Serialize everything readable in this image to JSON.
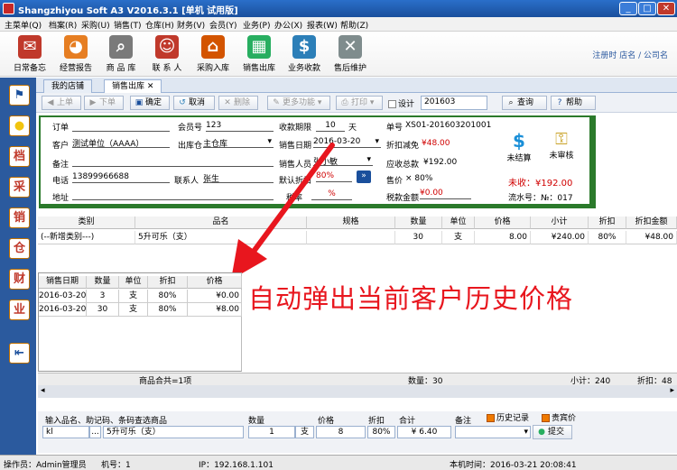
{
  "window": {
    "title": "Shangzhiyou Soft A3 V2016.3.1 [单机 试用版]",
    "min": "_",
    "max": "□",
    "close": "✕"
  },
  "menu": [
    "主菜单(Q)",
    "档案(R)",
    "采购(U)",
    "销售(T)",
    "仓库(H)",
    "财务(V)",
    "会员(Y)",
    "业务(P)",
    "办公(X)",
    "报表(W)",
    "帮助(Z)"
  ],
  "toolbar": [
    {
      "label": "日常备忘",
      "icon": "envelope-icon",
      "glyph": "✉",
      "color": "#c0392b"
    },
    {
      "label": "经营报告",
      "icon": "pie-chart-icon",
      "glyph": "◕",
      "color": "#e67e22"
    },
    {
      "label": "商 品 库",
      "icon": "magnifier-icon",
      "glyph": "⌕",
      "color": "#7a7a7a"
    },
    {
      "label": "联 系 人",
      "icon": "person-icon",
      "glyph": "☺",
      "color": "#c0392b"
    },
    {
      "label": "采购入库",
      "icon": "house-icon",
      "glyph": "⌂",
      "color": "#d35400"
    },
    {
      "label": "销售出库",
      "icon": "cash-icon",
      "glyph": "▦",
      "color": "#27ae60"
    },
    {
      "label": "业务收款",
      "icon": "dollar-icon",
      "glyph": "$",
      "color": "#2c7fb8"
    },
    {
      "label": "售后维护",
      "icon": "tools-icon",
      "glyph": "✕",
      "color": "#7f8c8d"
    }
  ],
  "reginfo": "注册时 店名 / 公司名",
  "sidebar": [
    "⚑",
    "●",
    "档",
    "采",
    "销",
    "仓",
    "财",
    "业",
    "⇤"
  ],
  "tabs": [
    {
      "label": "我的店铺"
    },
    {
      "label": "销售出库",
      "close": "✕"
    }
  ],
  "actions": {
    "prev": "上单",
    "next": "下单",
    "confirm": "确定",
    "cancel": "取消",
    "delete": "删除",
    "more": "更多功能",
    "print": "打印",
    "settings": "设计",
    "period_value": "201603",
    "query": "查询",
    "help": "帮助"
  },
  "form": {
    "order_label": "订单",
    "member_label": "会员号",
    "member_value": "123",
    "due_label": "收款期限",
    "due_value": "10",
    "due_unit": "天",
    "docno_label": "单号",
    "docno_value": "XS01-201603201001",
    "customer_label": "客户",
    "customer_value": "测试单位（AAAA）",
    "warehouse_label": "出库仓",
    "warehouse_value": "主仓库",
    "date_label": "销售日期",
    "date_value": "2016-03-20",
    "discount_amt_label": "折扣减免",
    "discount_amt_value": "¥48.00",
    "remark_label": "备注",
    "salesman_label": "销售人员",
    "salesman_value": "张小敏",
    "receivable_label": "应收总款",
    "receivable_value": "¥192.00",
    "phone_label": "电话",
    "phone_value": "13899966688",
    "contact_label": "联系人",
    "contact_value": "张生",
    "default_disc_label": "默认折扣",
    "default_disc_value": "80%",
    "sale_price_label": "售价",
    "sale_price_value": "× 80%",
    "address_label": "地址",
    "rate_label": "税率",
    "rate_value": "%",
    "tax_label": "税款金额",
    "tax_value": "¥0.00",
    "settle_label": "未结算",
    "audit_label": "未审核",
    "unreceived": "未收：¥192.00",
    "serial": "流水号：№：017"
  },
  "grid": {
    "headers": [
      "类别",
      "品名",
      "规格",
      "数量",
      "单位",
      "价格",
      "小计",
      "折扣",
      "折扣金额"
    ],
    "row": [
      "(--新增类别---)",
      "5升可乐（支）",
      "",
      "30",
      "支",
      "8.00",
      "¥240.00",
      "80%",
      "¥48.00"
    ]
  },
  "popup": {
    "headers": [
      "销售日期",
      "数量",
      "单位",
      "折扣",
      "价格"
    ],
    "rows": [
      [
        "2016-03-20",
        "3",
        "支",
        "80%",
        "¥0.00"
      ],
      [
        "2016-03-20",
        "30",
        "支",
        "80%",
        "¥8.00"
      ]
    ]
  },
  "overlay": "自动弹出当前客户历史价格",
  "summary": {
    "product_total": "商品合共=1项",
    "qty_label": "数量：30",
    "subtotal_label": "小计：240",
    "disc_label": "折扣：48"
  },
  "entry": {
    "search_label": "输入品名、助记码、条码查选商品",
    "qty_label": "数量",
    "price_label": "价格",
    "disc_label": "折扣",
    "total_label": "合计",
    "remark_label": "备注",
    "history_label": "历史记录",
    "vip_label": "贵宾价",
    "code_value": "kl",
    "dots": "...",
    "name_value": "5升可乐（支）",
    "qty_value": "1",
    "unit_value": "支",
    "price_value": "8",
    "disc_value": "80%",
    "total_value": "¥ 6.40",
    "submit": "提交"
  },
  "status": {
    "operator": "操作员：Admin管理员",
    "machine": "机号：1",
    "ip": "IP：192.168.1.101",
    "time": "本机时间：2016-03-21 20:08:41"
  }
}
